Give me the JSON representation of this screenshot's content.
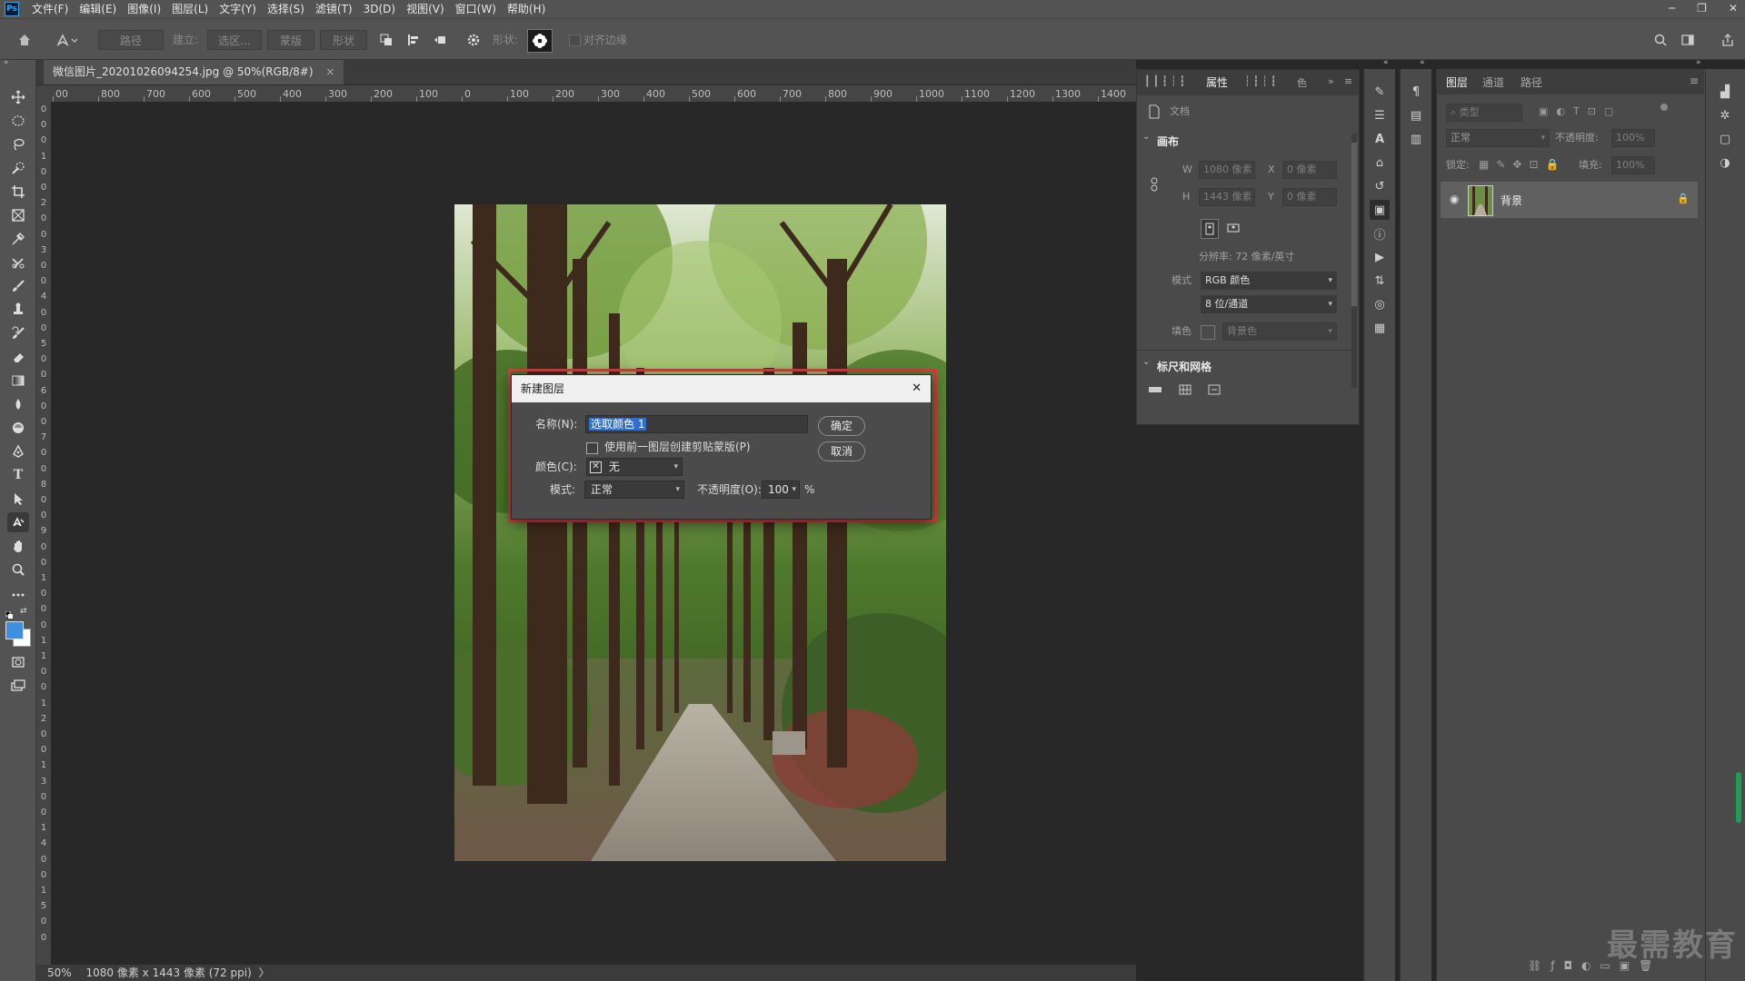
{
  "menubar": {
    "logo": "Ps",
    "items": [
      "文件(F)",
      "编辑(E)",
      "图像(I)",
      "图层(L)",
      "文字(Y)",
      "选择(S)",
      "滤镜(T)",
      "3D(D)",
      "视图(V)",
      "窗口(W)",
      "帮助(H)"
    ],
    "window_controls": [
      "─",
      "❐",
      "✕"
    ]
  },
  "options_bar": {
    "path_mode": "路径",
    "make_label": "建立:",
    "selection_btn": "选区...",
    "mask_btn": "蒙版",
    "shape_btn": "形状",
    "shape_label": "形状:",
    "align_edges": "对齐边缘"
  },
  "document": {
    "tab_title": "微信图片_20201026094254.jpg @ 50%(RGB/8#)",
    "tab_close": "×",
    "ruler_h_labels": [
      "00",
      "800",
      "700",
      "600",
      "500",
      "400",
      "300",
      "200",
      "100",
      "0",
      "100",
      "200",
      "300",
      "400",
      "500",
      "600",
      "700",
      "800",
      "900",
      "1000",
      "1100",
      "1200",
      "1300",
      "1400"
    ],
    "ruler_v_labels": [
      "0",
      "0",
      "0",
      "1",
      "0",
      "0",
      "2",
      "0",
      "0",
      "3",
      "0",
      "0",
      "4",
      "0",
      "0",
      "5",
      "0",
      "0",
      "6",
      "0",
      "0",
      "7",
      "0",
      "0",
      "8",
      "0",
      "0",
      "9",
      "0",
      "0",
      "1",
      "0",
      "0",
      "0",
      "1",
      "1",
      "0",
      "0",
      "1",
      "2",
      "0",
      "0",
      "1",
      "3",
      "0",
      "0",
      "1",
      "4",
      "0",
      "0",
      "1",
      "5",
      "0",
      "0"
    ]
  },
  "status": {
    "zoom": "50%",
    "info": "1080 像素 x 1443 像素 (72 ppi)",
    "arrow": "〉"
  },
  "dialog": {
    "title": "新建图层",
    "name_label": "名称(N):",
    "name_value": "选取颜色 1",
    "clip_label": "使用前一图层创建剪贴蒙版(P)",
    "color_label": "颜色(C):",
    "color_value": "无",
    "mode_label": "模式:",
    "mode_value": "正常",
    "opacity_label": "不透明度(O):",
    "opacity_value": "100",
    "opacity_unit": "%",
    "ok": "确定",
    "cancel": "取消",
    "close": "✕"
  },
  "properties": {
    "tab_active": "属性",
    "tab_misc": "色",
    "doc_label": "文档",
    "canvas_title": "画布",
    "w_label": "W",
    "w_value": "1080 像素",
    "h_label": "H",
    "h_value": "1443 像素",
    "x_label": "X",
    "x_value": "0 像素",
    "y_label": "Y",
    "y_value": "0 像素",
    "resolution": "分辨率: 72 像素/英寸",
    "mode_label": "模式",
    "mode_value": "RGB 颜色",
    "depth_value": "8 位/通道",
    "fill_label": "填色",
    "fill_value": "背景色",
    "rulers_title": "标尺和网格"
  },
  "layers": {
    "tabs": [
      "图层",
      "通道",
      "路径"
    ],
    "filter_label": "类型",
    "blend_mode": "正常",
    "opacity_label": "不透明度:",
    "opacity_value": "100%",
    "lock_label": "锁定:",
    "fill_label": "填充:",
    "fill_value": "100%",
    "layer_name": "背景"
  },
  "watermark": "最需教育",
  "colors": {
    "accent_red": "#e03a3e",
    "selection_blue": "#2f6fd1",
    "foreground": "#3d8fe0",
    "background": "#ffffff"
  }
}
